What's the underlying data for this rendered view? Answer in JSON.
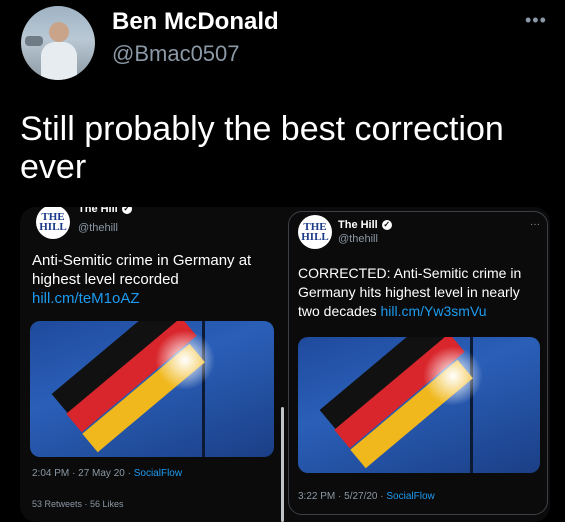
{
  "author": {
    "name": "Ben McDonald",
    "handle": "@Bmac0507",
    "more_icon": "more-horizontal-icon"
  },
  "tweet": {
    "text": "Still probably the best correction ever"
  },
  "left_tweet": {
    "account_name": "The Hill",
    "handle": "@thehill",
    "logo_line1": "THE",
    "logo_line2": "HILL",
    "text": "Anti-Semitic crime in Germany at highest level recorded ",
    "link": "hill.cm/teM1oAZ",
    "time": "2:04 PM · 27 May 20 · ",
    "source": "SocialFlow",
    "cut_stats": "53 Retweets · 56 Likes"
  },
  "right_tweet": {
    "account_name": "The Hill",
    "handle": "@thehill",
    "logo_line1": "THE",
    "logo_line2": "HILL",
    "text": "CORRECTED: Anti-Semitic crime in Germany hits highest level in nearly two decades ",
    "link": "hill.cm/Yw3smVu",
    "time": "3:22 PM · 5/27/20 · ",
    "source": "SocialFlow",
    "more": "···"
  }
}
